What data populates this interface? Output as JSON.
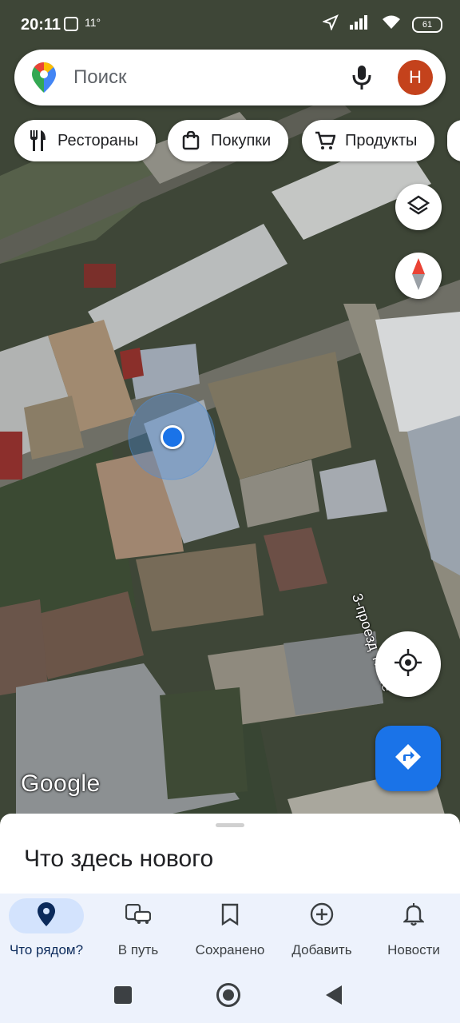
{
  "status_bar": {
    "time": "20:11",
    "temperature": "11°",
    "battery": "61"
  },
  "search": {
    "placeholder": "Поиск",
    "avatar_letter": "Н"
  },
  "chips": [
    {
      "label": "Рестораны",
      "icon": "restaurant-icon"
    },
    {
      "label": "Покупки",
      "icon": "shopping-bag-icon"
    },
    {
      "label": "Продукты",
      "icon": "cart-icon"
    }
  ],
  "map": {
    "street_label": "3-проезд Тикле",
    "watermark": "Google"
  },
  "sheet": {
    "title": "Что здесь нового"
  },
  "bottom_nav": [
    {
      "label": "Что рядом?",
      "icon": "place-icon",
      "active": true
    },
    {
      "label": "В путь",
      "icon": "commute-icon"
    },
    {
      "label": "Сохранено",
      "icon": "bookmark-icon"
    },
    {
      "label": "Добавить",
      "icon": "add-circle-icon"
    },
    {
      "label": "Новости",
      "icon": "bell-icon"
    }
  ],
  "colors": {
    "accent": "#1a73e8",
    "avatar": "#c4421c",
    "nav_background": "#edf2fc",
    "active_pill": "#d3e3fd"
  }
}
